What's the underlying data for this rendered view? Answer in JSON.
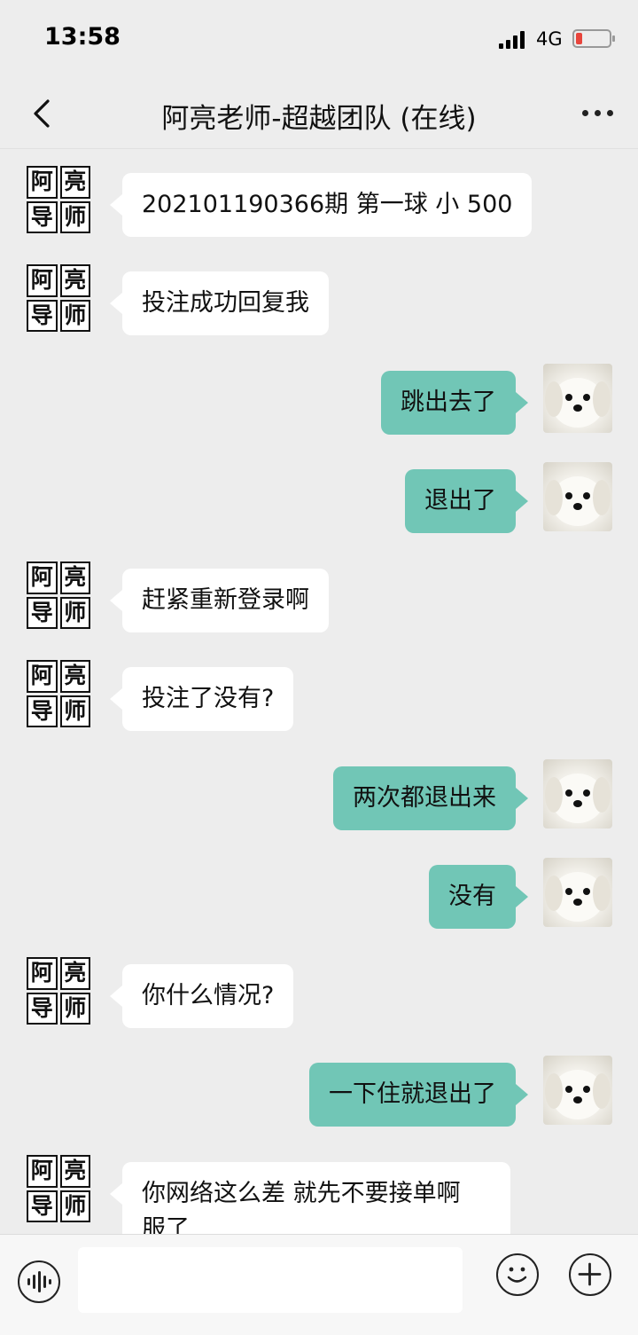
{
  "status_bar": {
    "time": "13:58",
    "network": "4G"
  },
  "header": {
    "title": "阿亮老师-超越团队 (在线)"
  },
  "teacher_avatar": {
    "chars": [
      "阿",
      "亮",
      "导",
      "师"
    ]
  },
  "messages": [
    {
      "side": "left",
      "text": "202101190366期 第一球 小 500"
    },
    {
      "side": "left",
      "text": "投注成功回复我"
    },
    {
      "side": "right",
      "text": "跳出去了"
    },
    {
      "side": "right",
      "text": "退出了"
    },
    {
      "side": "left",
      "text": "赶紧重新登录啊"
    },
    {
      "side": "left",
      "text": "投注了没有?"
    },
    {
      "side": "right",
      "text": "两次都退出来"
    },
    {
      "side": "right",
      "text": "没有"
    },
    {
      "side": "left",
      "text": "你什么情况?"
    },
    {
      "side": "right",
      "text": "一下住就退出了"
    },
    {
      "side": "left",
      "text": "你网络这么差 就先不要接单啊 服了"
    }
  ],
  "input": {
    "value": ""
  },
  "colors": {
    "sent_bubble": "#71c6b6",
    "received_bubble": "#ffffff",
    "background": "#ededed"
  }
}
